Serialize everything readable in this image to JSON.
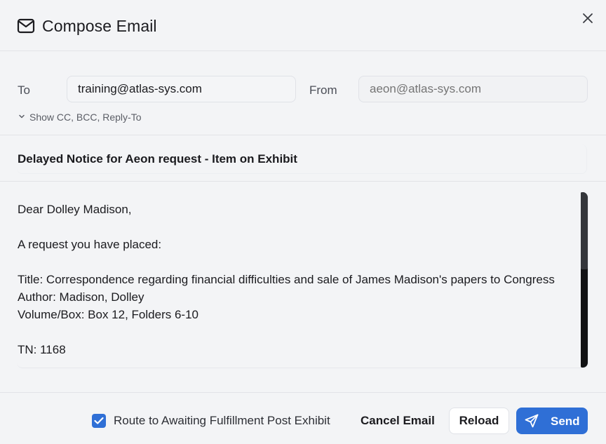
{
  "header": {
    "title": "Compose Email",
    "icon": "mail-icon",
    "close_icon": "close-icon"
  },
  "address": {
    "to_label": "To",
    "to_value": "training@atlas-sys.com",
    "from_label": "From",
    "from_placeholder": "aeon@atlas-sys.com",
    "show_cc_label": "Show CC, BCC, Reply-To"
  },
  "subject": {
    "value": "Delayed Notice for Aeon request - Item on Exhibit"
  },
  "body": {
    "text": "Dear Dolley Madison,\n\nA request you have placed:\n\nTitle: Correspondence regarding financial difficulties and sale of James Madison's papers to Congress\nAuthor: Madison, Dolley\nVolume/Box: Box 12, Folders 6-10\n\nTN: 1168"
  },
  "footer": {
    "route_checkbox_label": "Route to Awaiting Fulfillment Post Exhibit",
    "route_checked": true,
    "cancel_label": "Cancel Email",
    "reload_label": "Reload",
    "send_label": "Send"
  },
  "colors": {
    "accent": "#2f6fd6",
    "background": "#f3f4f6",
    "scrollbar": "#111214"
  }
}
